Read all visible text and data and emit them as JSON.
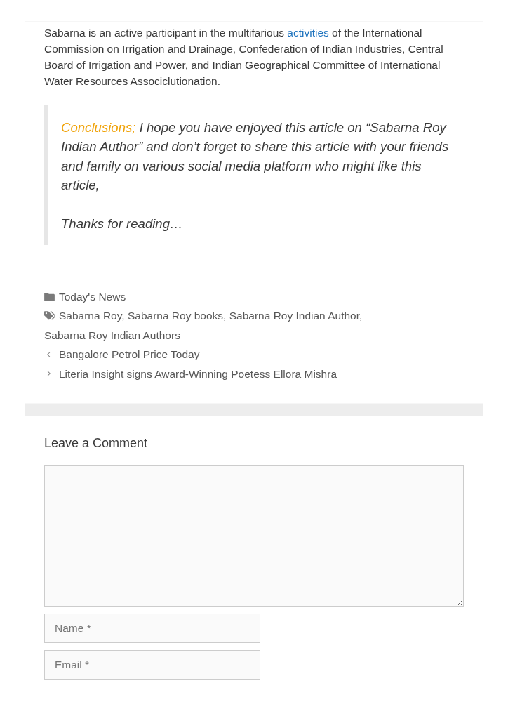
{
  "article": {
    "paragraph": {
      "before": "Sabarna is an active participant in the multifarious",
      "link": "activities",
      "after": "of the International Commission on Irrigation and Drainage, Confederation of Indian Industries, Central Board of Irrigation and Power, and Indian Geographical Committee of International Water Resources Associclutionation."
    },
    "blockquote": {
      "lead": "Conclusions;",
      "text": "I hope you have enjoyed this article on “Sabarna Roy Indian Author” and don’t forget to share this article with your friends and family on various social media platform who might like this article,",
      "closing": "Thanks for reading…"
    }
  },
  "meta": {
    "category": "Today's News",
    "tags": [
      "Sabarna Roy",
      "Sabarna Roy books",
      "Sabarna Roy Indian Author",
      "Sabarna Roy Indian Authors"
    ],
    "tag_separator": ","
  },
  "post_nav": [
    {
      "kind": "previous",
      "title": "Bangalore Petrol Price Today"
    },
    {
      "kind": "next",
      "title": "Literia Insight signs Award-Winning Poetess Ellora Mishra"
    }
  ],
  "comments": {
    "title": "Leave a Comment",
    "fields": [
      {
        "kind": "textarea"
      },
      {
        "kind": "input",
        "placeholder": "Name *"
      },
      {
        "kind": "input",
        "placeholder": "Email *"
      }
    ]
  }
}
